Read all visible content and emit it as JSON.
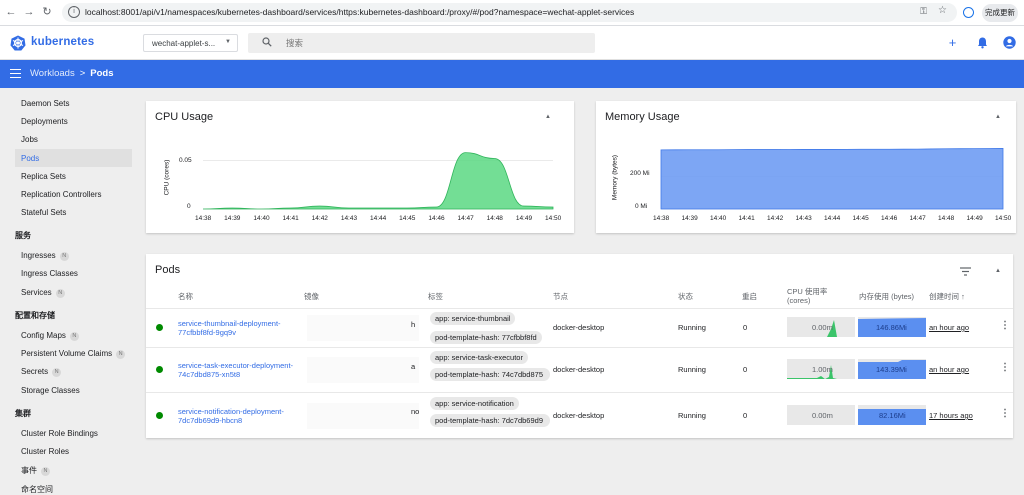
{
  "browser": {
    "url": "localhost:8001/api/v1/namespaces/kubernetes-dashboard/services/https:kubernetes-dashboard:/proxy/#/pod?namespace=wechat-applet-services",
    "update_label": "完成更新"
  },
  "header": {
    "brand": "kubernetes",
    "namespace": "wechat-applet-s...",
    "search_placeholder": "搜索"
  },
  "toolbar": {
    "breadcrumb_parent": "Workloads",
    "breadcrumb_sep": ">",
    "breadcrumb_current": "Pods"
  },
  "sidebar": {
    "workload_items": [
      "Daemon Sets",
      "Deployments",
      "Jobs",
      "Pods",
      "Replica Sets",
      "Replication Controllers",
      "Stateful Sets"
    ],
    "service_head": "服务",
    "service_items": [
      "Ingresses",
      "Ingress Classes",
      "Services"
    ],
    "config_head": "配置和存储",
    "config_items": [
      "Config Maps",
      "Persistent Volume Claims",
      "Secrets",
      "Storage Classes"
    ],
    "cluster_head": "集群",
    "cluster_items": [
      "Cluster Role Bindings",
      "Cluster Roles",
      "事件",
      "命名空间"
    ],
    "badge": "N"
  },
  "cpu_card": {
    "title": "CPU Usage",
    "ylabel": "CPU (cores)",
    "yticks": [
      "0.05",
      "0"
    ],
    "xticks": [
      "14:38",
      "14:39",
      "14:40",
      "14:41",
      "14:42",
      "14:43",
      "14:44",
      "14:45",
      "14:46",
      "14:47",
      "14:48",
      "14:49",
      "14:50"
    ]
  },
  "mem_card": {
    "title": "Memory Usage",
    "ylabel": "Memory (bytes)",
    "yticks": [
      "200 Mi",
      "0 Mi"
    ],
    "xticks": [
      "14:38",
      "14:39",
      "14:40",
      "14:41",
      "14:42",
      "14:43",
      "14:44",
      "14:45",
      "14:46",
      "14:47",
      "14:48",
      "14:49",
      "14:50"
    ]
  },
  "chart_data": [
    {
      "type": "area",
      "title": "CPU Usage",
      "ylabel": "CPU (cores)",
      "x": [
        "14:38",
        "14:39",
        "14:40",
        "14:41",
        "14:42",
        "14:43",
        "14:44",
        "14:45",
        "14:46",
        "14:47",
        "14:48",
        "14:49",
        "14:50"
      ],
      "y": [
        0,
        0.001,
        0,
        0.001,
        0.003,
        0.001,
        0.001,
        0.001,
        0.002,
        0.058,
        0.052,
        0.003,
        0.002
      ],
      "ylim": [
        0,
        0.07
      ],
      "color": "#4ad07a"
    },
    {
      "type": "area",
      "title": "Memory Usage",
      "ylabel": "Memory (bytes)",
      "x": [
        "14:38",
        "14:39",
        "14:40",
        "14:41",
        "14:42",
        "14:43",
        "14:44",
        "14:45",
        "14:46",
        "14:47",
        "14:48",
        "14:49",
        "14:50"
      ],
      "y": [
        365,
        366,
        366,
        367,
        367,
        368,
        368,
        369,
        369,
        370,
        372,
        373,
        374
      ],
      "ylim": [
        0,
        420
      ],
      "color": "#5b8ff0"
    }
  ],
  "pods": {
    "title": "Pods",
    "columns": {
      "name": "名称",
      "image": "镜像",
      "labels": "标签",
      "node": "节点",
      "status": "状态",
      "restarts": "重启",
      "cpu": "CPU 使用率 (cores)",
      "mem": "内存使用 (bytes)",
      "created": "创建时间 ↑"
    },
    "rows": [
      {
        "name": "service-thumbnail-deployment-77cfbbf8fd-9gq9v",
        "image_tail": "h",
        "label1": "app: service-thumbnail",
        "label2": "pod-template-hash: 77cfbbf8fd",
        "node": "docker-desktop",
        "status": "Running",
        "restarts": "0",
        "cpu": "0.00m",
        "mem": "146.86Mi",
        "created": "an hour ago"
      },
      {
        "name": "service-task-executor-deployment-74c7dbd875-xn5t8",
        "image_tail": "a",
        "label1": "app: service-task-executor",
        "label2": "pod-template-hash: 74c7dbd875",
        "node": "docker-desktop",
        "status": "Running",
        "restarts": "0",
        "cpu": "1.00m",
        "mem": "143.39Mi",
        "created": "an hour ago"
      },
      {
        "name": "service-notification-deployment-7dc7db69d9-hbcn8",
        "image_tail": "no",
        "label1": "app: service-notification",
        "label2": "pod-template-hash: 7dc7db69d9",
        "node": "docker-desktop",
        "status": "Running",
        "restarts": "0",
        "cpu": "0.00m",
        "mem": "82.16Mi",
        "created": "17 hours ago"
      }
    ]
  }
}
